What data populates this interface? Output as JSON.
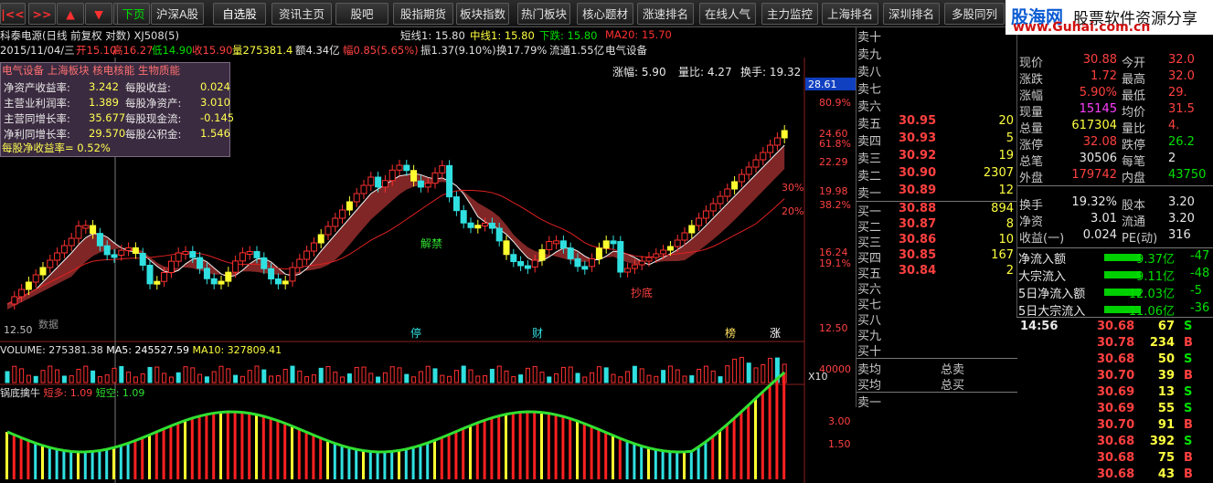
{
  "toolbar": {
    "buttons": [
      {
        "label": "|<<",
        "color": "red"
      },
      {
        "label": ">>",
        "color": "red"
      },
      {
        "label": "▲",
        "color": "red"
      },
      {
        "label": "▼",
        "color": "red"
      },
      {
        "label": "✕",
        "color": "red"
      },
      {
        "label": "下页",
        "color": "green"
      },
      {
        "label": "沪深A股",
        "color": ""
      },
      {
        "label": "自选股",
        "color": "active"
      },
      {
        "label": "资讯主页",
        "color": ""
      },
      {
        "label": "股吧",
        "color": ""
      },
      {
        "label": "股指期货",
        "color": ""
      },
      {
        "label": "板块指数",
        "color": ""
      },
      {
        "label": "热门板块",
        "color": ""
      },
      {
        "label": "核心题材",
        "color": ""
      },
      {
        "label": "涨速排名",
        "color": ""
      },
      {
        "label": "在线人气",
        "color": ""
      },
      {
        "label": "主力监控",
        "color": ""
      },
      {
        "label": "上海排名",
        "color": ""
      },
      {
        "label": "深圳排名",
        "color": ""
      },
      {
        "label": "多股同列",
        "color": ""
      }
    ]
  },
  "logo": {
    "name": "股海网",
    "slogan": "股票软件资源分享",
    "url": "www.Guhai.com.cn"
  },
  "chart": {
    "title": "科泰电源(日线 前复权 对数) XJ508(5)",
    "ma_short": "短线1: 15.80",
    "ma_mid": "中线1: 15.80",
    "trend": "下跌: 15.80",
    "ma20": "MA20: 15.70",
    "date_line": "2015/11/04/三",
    "open": "开15.10",
    "high": "高16.27",
    "low": "低14.90",
    "close": "收15.90",
    "volume": "量275381.4",
    "amount": "额4.34亿",
    "amplitude_pct": "幅0.85(5.65%)",
    "swing": "振1.37(9.10%)",
    "turnover": "换17.79%",
    "float": "流通1.55亿",
    "sector": "电气设备",
    "stat_zf": "涨幅: 5.90",
    "stat_lb": "量比: 4.27",
    "stat_hs": "换手: 19.32",
    "concepts": "电气设备 上海板块 核电核能 生物质能",
    "fundamentals": [
      {
        "label": "净资产收益率:",
        "value": "3.242",
        "label2": "每股收益:",
        "value2": "0.024"
      },
      {
        "label": "主营业利润率:",
        "value": "1.389",
        "label2": "每股净资产:",
        "value2": "3.010"
      },
      {
        "label": "主营同增长率:",
        "value": "35.677",
        "label2": "每股现金流:",
        "value2": "-0.145"
      },
      {
        "label": "净利同增长率:",
        "value": "29.570",
        "label2": "每股公积金:",
        "value2": "1.546"
      }
    ],
    "eps_yield": "每股净收益率= 0.52%",
    "right_axis": [
      "28.61",
      "80.9%",
      "24.60",
      "61.8%",
      "22.29",
      "19.98",
      "38.2%",
      "16.24",
      "19.1%",
      "12.50"
    ],
    "pct_labels": [
      "30%",
      "20%"
    ],
    "annotations": [
      "解禁",
      "抄底",
      "停",
      "财",
      "榜",
      "涨"
    ],
    "bottom_left": "12.50",
    "bottom_left_note": "数据"
  },
  "volume": {
    "label": "VOLUME: 275381.38",
    "ma5": "MA5: 245527.59",
    "ma10": "MA10: 327809.41",
    "axis": "40000",
    "unit": "X10"
  },
  "indicator": {
    "name": "锅底擒牛",
    "duo": "短多: 1.09",
    "kong": "短空: 1.09",
    "axis": [
      "3.00",
      "1.50"
    ]
  },
  "orderbook": {
    "sell": [
      {
        "label": "卖十",
        "price": "",
        "vol": ""
      },
      {
        "label": "卖九",
        "price": "",
        "vol": ""
      },
      {
        "label": "卖八",
        "price": "",
        "vol": ""
      },
      {
        "label": "卖七",
        "price": "",
        "vol": ""
      },
      {
        "label": "卖六",
        "price": "",
        "vol": ""
      },
      {
        "label": "卖五",
        "price": "30.95",
        "vol": "20"
      },
      {
        "label": "卖四",
        "price": "30.93",
        "vol": "5"
      },
      {
        "label": "卖三",
        "price": "30.92",
        "vol": "19"
      },
      {
        "label": "卖二",
        "price": "30.90",
        "vol": "2307"
      },
      {
        "label": "卖一",
        "price": "30.89",
        "vol": "12"
      }
    ],
    "buy": [
      {
        "label": "买一",
        "price": "30.88",
        "vol": "894"
      },
      {
        "label": "买二",
        "price": "30.87",
        "vol": "8"
      },
      {
        "label": "买三",
        "price": "30.86",
        "vol": "10"
      },
      {
        "label": "买四",
        "price": "30.85",
        "vol": "167"
      },
      {
        "label": "买五",
        "price": "30.84",
        "vol": "2"
      },
      {
        "label": "买六",
        "price": "",
        "vol": ""
      },
      {
        "label": "买七",
        "price": "",
        "vol": ""
      },
      {
        "label": "买八",
        "price": "",
        "vol": ""
      },
      {
        "label": "买九",
        "price": "",
        "vol": ""
      },
      {
        "label": "买十",
        "price": "",
        "vol": ""
      }
    ],
    "sell_avg": "卖均",
    "buy_avg": "买均",
    "total_sell": "总卖",
    "total_buy": "总买",
    "bottom_label": "卖一"
  },
  "quote": [
    {
      "l1": "现价",
      "v1": "30.88",
      "c1": "red",
      "l2": "今开",
      "v2": "32.0",
      "c2": "red"
    },
    {
      "l1": "涨跌",
      "v1": "1.72",
      "c1": "red",
      "l2": "最高",
      "v2": "32.0",
      "c2": "red"
    },
    {
      "l1": "涨幅",
      "v1": "5.90%",
      "c1": "red",
      "l2": "最低",
      "v2": "29.",
      "c2": "red"
    },
    {
      "l1": "现量",
      "v1": "15145",
      "c1": "mag",
      "l2": "均价",
      "v2": "31.5",
      "c2": "red"
    },
    {
      "l1": "总量",
      "v1": "617304",
      "c1": "yel",
      "l2": "量比",
      "v2": "4.",
      "c2": "red"
    },
    {
      "l1": "涨停",
      "v1": "32.08",
      "c1": "red",
      "l2": "跌停",
      "v2": "26.2",
      "c2": "grn"
    },
    {
      "l1": "总笔",
      "v1": "30506",
      "c1": "wht",
      "l2": "每笔",
      "v2": "2",
      "c2": "wht"
    },
    {
      "l1": "外盘",
      "v1": "179742",
      "c1": "red",
      "l2": "内盘",
      "v2": "43750",
      "c2": "grn"
    },
    {
      "l1": "换手",
      "v1": "19.32%",
      "c1": "wht",
      "l2": "股本",
      "v2": "3.20",
      "c2": "wht"
    },
    {
      "l1": "净资",
      "v1": "3.01",
      "c1": "wht",
      "l2": "流通",
      "v2": "3.20",
      "c2": "wht"
    },
    {
      "l1": "收益(一)",
      "v1": "0.024",
      "c1": "wht",
      "l2": "PE(动)",
      "v2": "316",
      "c2": "wht"
    }
  ],
  "flows": [
    {
      "label": "净流入额",
      "value": "-9.37亿",
      "tail": "-47"
    },
    {
      "label": "大宗流入",
      "value": "-9.11亿",
      "tail": "-48"
    },
    {
      "label": "5日净流入额",
      "value": "-12.03亿",
      "tail": "-5"
    },
    {
      "label": "5日大宗流入",
      "value": "-11.06亿",
      "tail": "-36"
    }
  ],
  "ticks": [
    {
      "time": "14:56",
      "price": "30.68",
      "vol": "67",
      "side": "S"
    },
    {
      "time": "",
      "price": "30.78",
      "vol": "234",
      "side": "B"
    },
    {
      "time": "",
      "price": "30.68",
      "vol": "50",
      "side": "S"
    },
    {
      "time": "",
      "price": "30.70",
      "vol": "39",
      "side": "B"
    },
    {
      "time": "",
      "price": "30.69",
      "vol": "13",
      "side": "S"
    },
    {
      "time": "",
      "price": "30.69",
      "vol": "55",
      "side": "S"
    },
    {
      "time": "",
      "price": "30.70",
      "vol": "91",
      "side": "B"
    },
    {
      "time": "",
      "price": "30.68",
      "vol": "392",
      "side": "S"
    },
    {
      "time": "",
      "price": "30.68",
      "vol": "75",
      "side": "B"
    },
    {
      "time": "",
      "price": "30.68",
      "vol": "43",
      "side": "B"
    }
  ]
}
